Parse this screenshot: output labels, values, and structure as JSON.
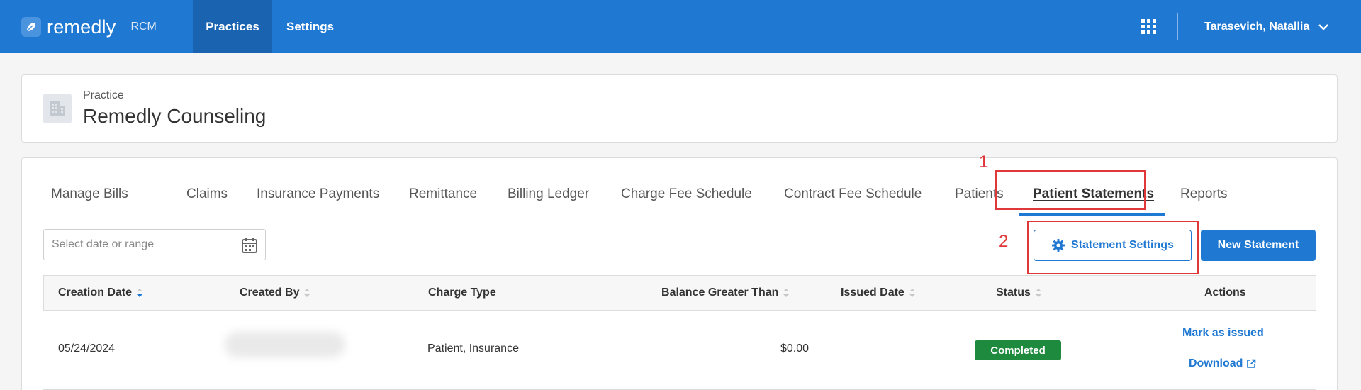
{
  "brand": {
    "name": "remedly",
    "sub": "RCM"
  },
  "nav": {
    "practices": "Practices",
    "settings": "Settings"
  },
  "user": {
    "name": "Tarasevich, Natallia"
  },
  "practice": {
    "label": "Practice",
    "name": "Remedly Counseling"
  },
  "tabs": [
    {
      "label": "Manage Bills"
    },
    {
      "label": "Claims"
    },
    {
      "label": "Insurance Payments"
    },
    {
      "label": "Remittance"
    },
    {
      "label": "Billing Ledger"
    },
    {
      "label": "Charge Fee Schedule"
    },
    {
      "label": "Contract Fee Schedule"
    },
    {
      "label": "Patients"
    },
    {
      "label": "Patient Statements"
    },
    {
      "label": "Reports"
    }
  ],
  "annotations": {
    "first": "1",
    "second": "2"
  },
  "filters": {
    "date_placeholder": "Select date or range"
  },
  "buttons": {
    "statement_settings": "Statement Settings",
    "new_statement": "New Statement"
  },
  "table": {
    "headers": {
      "creation_date": "Creation Date",
      "created_by": "Created By",
      "charge_type": "Charge Type",
      "balance": "Balance Greater Than",
      "issued_date": "Issued Date",
      "status": "Status",
      "actions": "Actions"
    },
    "rows": [
      {
        "creation_date": "05/24/2024",
        "charge_type": "Patient, Insurance",
        "balance": "$0.00",
        "issued_date": "",
        "status": "Completed",
        "action_mark": "Mark as issued",
        "action_download": "Download"
      }
    ]
  },
  "colors": {
    "brand_blue": "#1f78d1",
    "status_green": "#1e8a3e",
    "annotation_red": "#e0383a"
  }
}
